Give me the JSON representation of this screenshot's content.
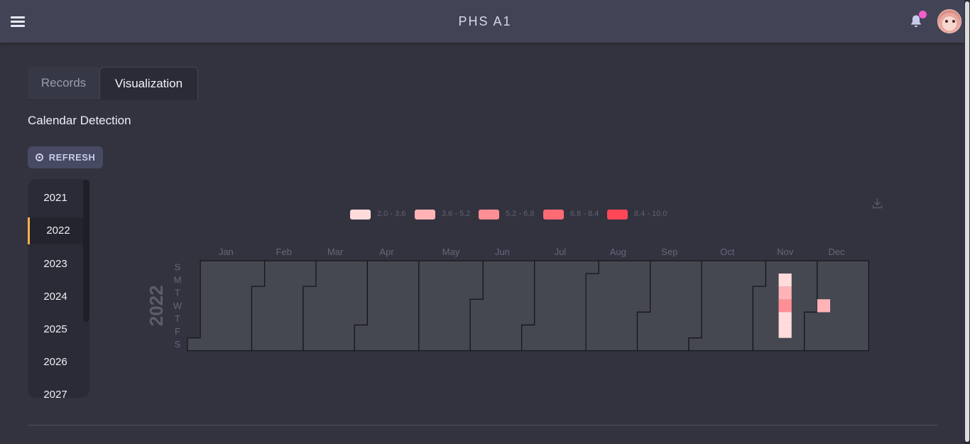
{
  "header": {
    "title": "PHS A1"
  },
  "tabs": [
    {
      "label": "Records",
      "active": false
    },
    {
      "label": "Visualization",
      "active": true
    }
  ],
  "section": {
    "title": "Calendar Detection"
  },
  "refresh_button": {
    "label": "REFRESH"
  },
  "years": [
    {
      "label": "2021",
      "active": false
    },
    {
      "label": "2022",
      "active": true
    },
    {
      "label": "2023",
      "active": false
    },
    {
      "label": "2024",
      "active": false
    },
    {
      "label": "2025",
      "active": false
    },
    {
      "label": "2026",
      "active": false
    },
    {
      "label": "2027",
      "active": false
    }
  ],
  "icons": {
    "menu": "hamburger-icon",
    "notifications": "bell-icon",
    "refresh": "refresh-icon",
    "download": "download-icon"
  },
  "colors": {
    "accent_active_year": "#f4b24a",
    "notification_dot": "#f25ec9"
  },
  "chart_data": {
    "type": "heatmap",
    "year": 2022,
    "year_label": "2022",
    "months": [
      "Jan",
      "Feb",
      "Mar",
      "Apr",
      "May",
      "Jun",
      "Jul",
      "Aug",
      "Sep",
      "Oct",
      "Nov",
      "Dec"
    ],
    "weekday_labels": [
      "S",
      "M",
      "T",
      "W",
      "T",
      "F",
      "S"
    ],
    "legend": [
      {
        "label": "2.0 - 3.6",
        "color": "#ffdcdb"
      },
      {
        "label": "3.6 - 5.2",
        "color": "#ffb3b6"
      },
      {
        "label": "5.2 - 6.8",
        "color": "#ff8f95"
      },
      {
        "label": "6.8 - 8.4",
        "color": "#ff6b75"
      },
      {
        "label": "8.4 - 10.0",
        "color": "#ff4757"
      }
    ],
    "values": [
      {
        "date": "2022-11-14",
        "value": 2.6
      },
      {
        "date": "2022-11-15",
        "value": 4.2
      },
      {
        "date": "2022-11-16",
        "value": 5.8
      },
      {
        "date": "2022-11-17",
        "value": 2.8
      },
      {
        "date": "2022-11-18",
        "value": 2.4
      },
      {
        "date": "2022-12-07",
        "value": 4.6
      }
    ]
  }
}
